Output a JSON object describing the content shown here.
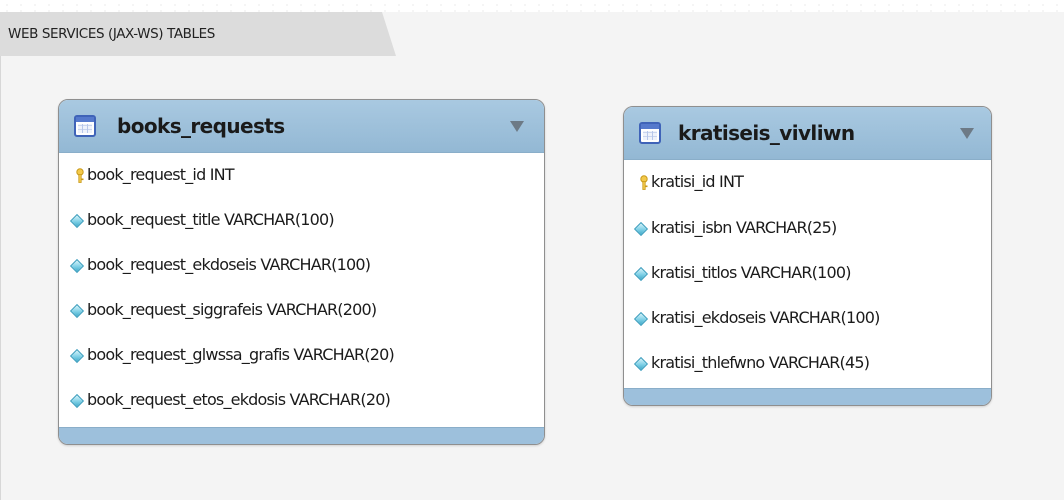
{
  "layer": {
    "title": "WEB SERVICES (JAX-WS) TABLES"
  },
  "tables": [
    {
      "name": "books_requests",
      "columns": [
        {
          "label": "book_request_id INT",
          "kind": "primary-key"
        },
        {
          "label": "book_request_title VARCHAR(100)",
          "kind": "column"
        },
        {
          "label": "book_request_ekdoseis VARCHAR(100)",
          "kind": "column"
        },
        {
          "label": "book_request_siggrafeis VARCHAR(200)",
          "kind": "column"
        },
        {
          "label": "book_request_glwssa_grafis VARCHAR(20)",
          "kind": "column"
        },
        {
          "label": "book_request_etos_ekdosis VARCHAR(20)",
          "kind": "column"
        }
      ]
    },
    {
      "name": "kratiseis_vivliwn",
      "columns": [
        {
          "label": "kratisi_id INT",
          "kind": "primary-key"
        },
        {
          "label": "kratisi_isbn VARCHAR(25)",
          "kind": "column"
        },
        {
          "label": "kratisi_titlos VARCHAR(100)",
          "kind": "column"
        },
        {
          "label": "kratisi_ekdoseis VARCHAR(100)",
          "kind": "column"
        },
        {
          "label": "kratisi_thlefwno VARCHAR(45)",
          "kind": "column"
        }
      ]
    }
  ],
  "colors": {
    "header": "#9dc0dc",
    "icon": "#3f63b8",
    "primary_key": "#f0c040",
    "column_marker": "#7fd0e6"
  }
}
